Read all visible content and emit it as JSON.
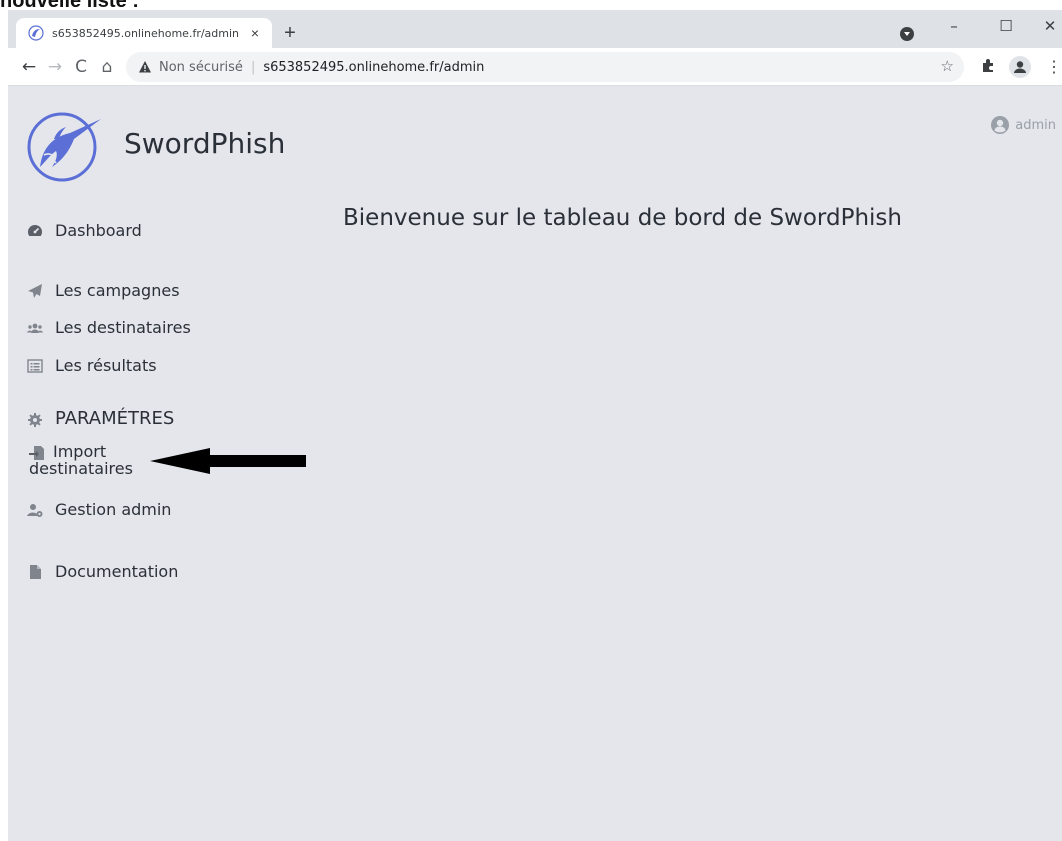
{
  "caption": "nouvelle liste :",
  "browser": {
    "tab": {
      "title": "s653852495.onlinehome.fr/admin",
      "close_glyph": "×"
    },
    "new_tab_glyph": "+",
    "window_controls": {
      "minimize": "–",
      "maximize": "☐",
      "close": "✕"
    },
    "nav": {
      "back": "←",
      "forward": "→",
      "reload": "C",
      "home": "⌂"
    },
    "omnibox": {
      "security_label": "Non sécurisé",
      "separator": "|",
      "url": "s653852495.onlinehome.fr/admin"
    },
    "icons": [
      "warning-icon",
      "star-icon",
      "extensions-icon",
      "profile-icon",
      "menu-icon"
    ]
  },
  "app": {
    "brand": "SwordPhish",
    "user": "admin",
    "welcome": "Bienvenue sur le tableau de bord de SwordPhish",
    "nav": {
      "dashboard": "Dashboard",
      "campagnes": "Les campagnes",
      "destinataires": "Les destinataires",
      "resultats": "Les résultats",
      "parametres": "PARAMÉTRES",
      "import_line1": "Import",
      "import_line2": "destinataires",
      "gestion_admin": "Gestion admin",
      "documentation": "Documentation"
    }
  },
  "colors": {
    "page_bg": "#e4e6ec",
    "logo_blue": "#5b6fd6",
    "text": "#2b3038",
    "muted": "#9aa0a8"
  }
}
